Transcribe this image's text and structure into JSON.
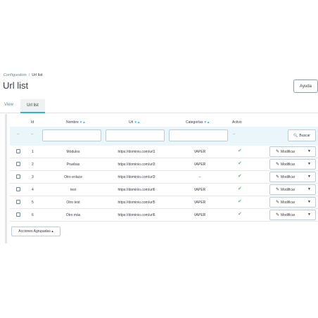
{
  "breadcrumb": {
    "parent": "Configuration",
    "separator": "/",
    "current": "Url list"
  },
  "page_title": "Url list",
  "help_button": "Ayuda",
  "tabs": [
    {
      "label": "View"
    },
    {
      "label": "Url list"
    }
  ],
  "table": {
    "headers": {
      "id": "Id",
      "nombre": "Nombre",
      "url": "Url",
      "categorias": "Categorías",
      "activo": "Activo",
      "sort_arrows": "▼▲"
    },
    "filter_dashes": {
      "checkbox": "--",
      "id": "--",
      "activo": "--"
    },
    "search_button": "Buscar",
    "modify_label": "Modificar",
    "rows": [
      {
        "id": "1",
        "nombre": "Módulos",
        "url": "https://dominio.com/url1",
        "categorias": "VAPER"
      },
      {
        "id": "2",
        "nombre": "Pruebas",
        "url": "https://dominio.com/url3",
        "categorias": "VAPER"
      },
      {
        "id": "3",
        "nombre": "Otro enlace",
        "url": "https://dominio.com/url3",
        "categorias": "--"
      },
      {
        "id": "4",
        "nombre": "test",
        "url": "https://dominio.com/url6",
        "categorias": "VAPER"
      },
      {
        "id": "5",
        "nombre": "Otro test",
        "url": "https://dominio.com/url5",
        "categorias": "VAPER"
      },
      {
        "id": "6",
        "nombre": "Otro más",
        "url": "https://dominio.com/url6",
        "categorias": "VAPER"
      }
    ]
  },
  "bulk_actions": "Acciones Agrupadas ▴",
  "colors": {
    "accent": "#25b9d7",
    "check": "#70b580",
    "filter_bg": "#eaf6fa"
  }
}
